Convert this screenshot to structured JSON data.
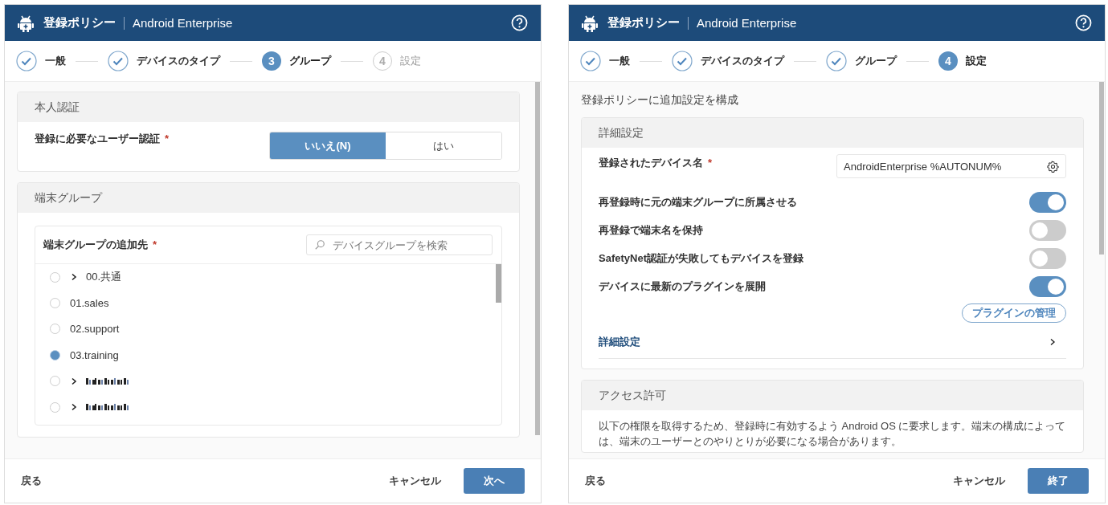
{
  "dialogs": [
    {
      "title": "登録ポリシー",
      "product": "Android Enterprise",
      "steps": [
        {
          "label": "一般",
          "done": true,
          "selected": false
        },
        {
          "label": "デバイスのタイプ",
          "done": true,
          "selected": false
        },
        {
          "label": "グループ",
          "done": false,
          "selected": true,
          "number": "3"
        },
        {
          "label": "設定",
          "done": false,
          "selected": false,
          "number": "4"
        }
      ],
      "sections": [
        {
          "kind": "segmented",
          "heading": "本人認証",
          "label": "登録に必要なユーザー認証",
          "required_mark": "*",
          "options": [
            {
              "label": "いいえ(N)",
              "selected": true
            },
            {
              "label": "はい",
              "selected": false
            }
          ]
        },
        {
          "kind": "tree",
          "heading": "端末グループ",
          "label": "端末グループの追加先",
          "required_mark": "*",
          "search_placeholder": "デバイスグループを検索",
          "items": [
            {
              "kind": "group",
              "label": "00.共通",
              "expandable": true,
              "selected": false
            },
            {
              "kind": "group",
              "label": "01.sales",
              "expandable": false,
              "selected": false
            },
            {
              "kind": "group",
              "label": "02.support",
              "expandable": false,
              "selected": false
            },
            {
              "kind": "group",
              "label": "03.training",
              "expandable": false,
              "selected": true
            },
            {
              "kind": "redacted",
              "expandable": true,
              "selected": false
            },
            {
              "kind": "redacted",
              "expandable": true,
              "selected": false
            }
          ]
        }
      ],
      "footer": {
        "back": "戻る",
        "cancel": "キャンセル",
        "primary": "次へ"
      }
    },
    {
      "title": "登録ポリシー",
      "product": "Android Enterprise",
      "steps": [
        {
          "label": "一般",
          "done": true,
          "selected": false
        },
        {
          "label": "デバイスのタイプ",
          "done": true,
          "selected": false
        },
        {
          "label": "グループ",
          "done": true,
          "selected": false
        },
        {
          "label": "設定",
          "done": false,
          "selected": true,
          "number": "4"
        }
      ],
      "intro": "登録ポリシーに追加設定を構成",
      "sections": [
        {
          "kind": "settings",
          "heading": "詳細設定",
          "rows": [
            {
              "kind": "field",
              "label": "登録されたデバイス名",
              "required_mark": "*",
              "value": "AndroidEnterprise %AUTONUM%"
            },
            {
              "kind": "toggle",
              "label": "再登録時に元の端末グループに所属させる",
              "on": true
            },
            {
              "kind": "toggle",
              "label": "再登録で端末名を保持",
              "on": false
            },
            {
              "kind": "toggle",
              "label": "SafetyNet認証が失敗してもデバイスを登録",
              "on": false
            },
            {
              "kind": "toggle",
              "label": "デバイスに最新のプラグインを展開",
              "on": true
            },
            {
              "kind": "button",
              "label": "プラグインの管理"
            },
            {
              "kind": "link",
              "label": "詳細設定"
            }
          ]
        },
        {
          "kind": "text",
          "heading": "アクセス許可",
          "text": "以下の権限を取得するため、登録時に有効するよう Android OS に要求します。端末の構成によっては、端末のユーザーとのやりとりが必要になる場合があります。"
        }
      ],
      "footer": {
        "back": "戻る",
        "cancel": "キャンセル",
        "primary": "終了"
      }
    }
  ]
}
